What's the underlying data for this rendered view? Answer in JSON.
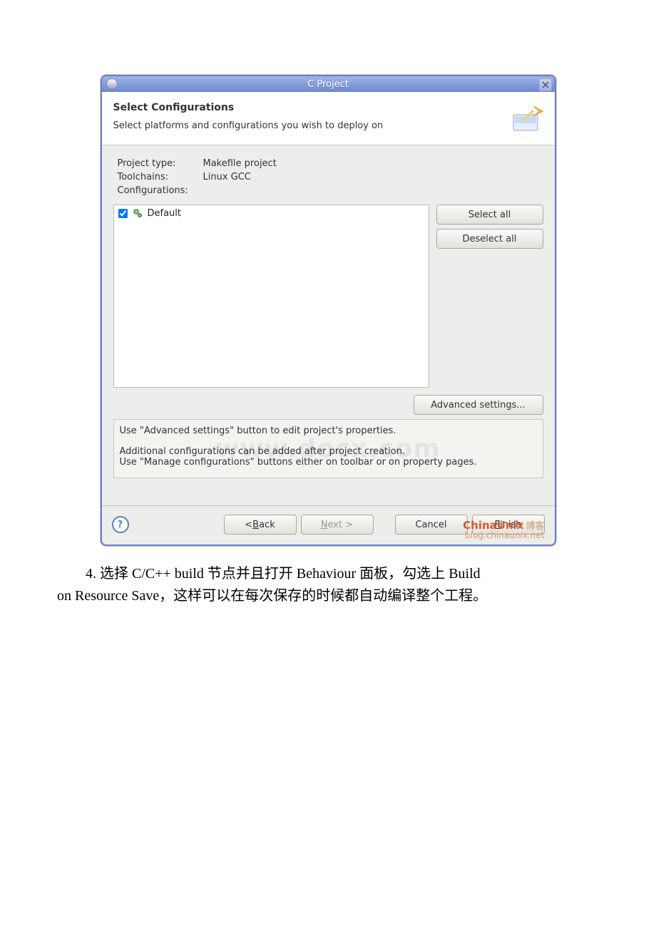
{
  "dialog": {
    "title": "C Project",
    "banner_heading": "Select Configurations",
    "banner_subtext": "Select platforms and configurations you wish to deploy on",
    "labels": {
      "project_type": "Project type:",
      "toolchains": "Toolchains:",
      "configurations": "Configurations:"
    },
    "values": {
      "project_type": "Makefile project",
      "toolchains": "Linux GCC"
    },
    "config_item": {
      "checked": true,
      "label": "Default"
    },
    "buttons": {
      "select_all": "Select all",
      "deselect_all": "Deselect all",
      "advanced": "Advanced settings...",
      "back": "< Back",
      "next": "Next >",
      "cancel": "Cancel",
      "finish": "Finish"
    },
    "note_line1": "Use \"Advanced settings\" button to edit project's properties.",
    "note_line2": "Additional configurations can be added after project creation.",
    "note_line3": "Use \"Manage configurations\" buttons either on toolbar or on property pages.",
    "watermark_main": "www.docx.com",
    "overlay": {
      "brand": "ChinaUnix",
      "brand_cn": "博客",
      "sub": "blog.chinaunix.net"
    }
  },
  "caption": {
    "line1_prefix": "4. 选择 C/C++ build 节点并且打开 Behaviour 面板，勾选上 Build",
    "line2": "on Resource Save，这样可以在每次保存的时候都自动编译整个工程。"
  },
  "mnemonics": {
    "back": "B",
    "next": "N",
    "finish": "F"
  }
}
